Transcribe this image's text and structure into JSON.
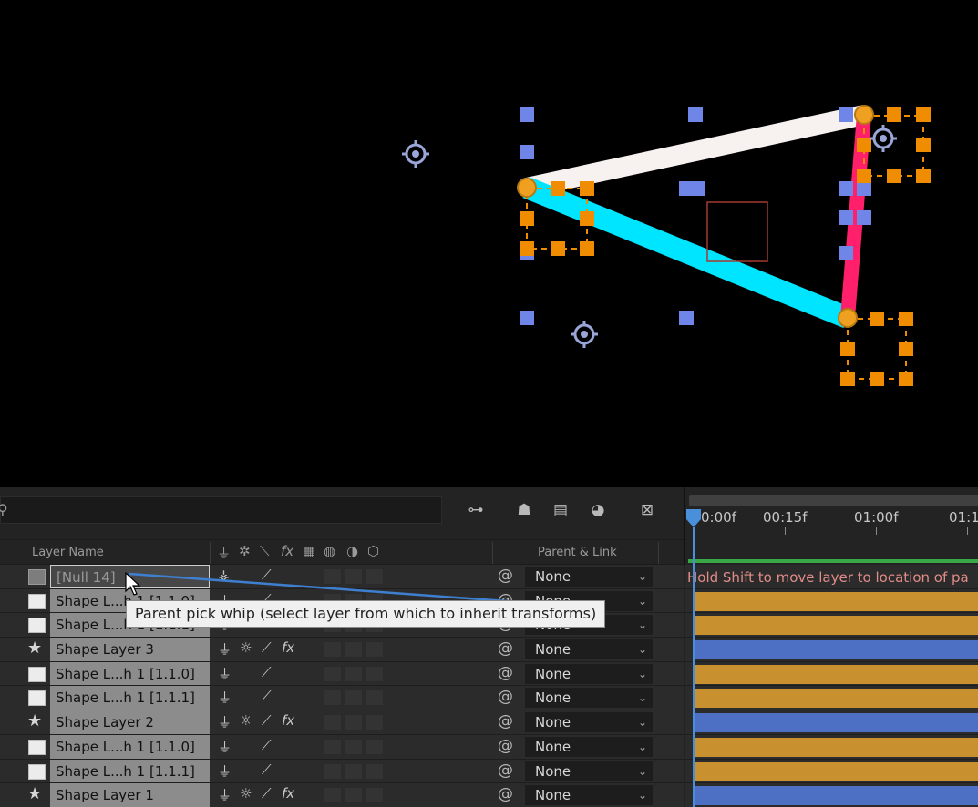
{
  "timeline": {
    "search_placeholder": "",
    "columns": {
      "layer_name": "Layer Name",
      "parent_link": "Parent & Link"
    },
    "ruler": [
      "0:00f",
      "00:15f",
      "01:00f",
      "01:1"
    ],
    "hint": "Hold Shift to move layer to location of pa",
    "tooltip": "Parent pick whip (select layer from which to inherit transforms)",
    "layers": [
      {
        "name": "[Null 14]",
        "type": "null",
        "parent": "None",
        "bar": "hint"
      },
      {
        "name": "Shape L...h 1 [1.1.0]",
        "type": "solid",
        "parent": "None",
        "bar": "orange"
      },
      {
        "name": "Shape L...h 1 [1.1.1]",
        "type": "solid",
        "parent": "None",
        "bar": "orange"
      },
      {
        "name": "Shape Layer 3",
        "type": "star",
        "parent": "None",
        "bar": "blue"
      },
      {
        "name": "Shape L...h 1 [1.1.0]",
        "type": "solid",
        "parent": "None",
        "bar": "orange"
      },
      {
        "name": "Shape L...h 1 [1.1.1]",
        "type": "solid",
        "parent": "None",
        "bar": "orange"
      },
      {
        "name": "Shape Layer 2",
        "type": "star",
        "parent": "None",
        "bar": "blue"
      },
      {
        "name": "Shape L...h 1 [1.1.0]",
        "type": "solid",
        "parent": "None",
        "bar": "orange"
      },
      {
        "name": "Shape L...h 1 [1.1.1]",
        "type": "solid",
        "parent": "None",
        "bar": "orange"
      },
      {
        "name": "Shape Layer 1",
        "type": "star",
        "parent": "None",
        "bar": "blue"
      }
    ]
  },
  "colors": {
    "accent_blue": "#4a8fd9",
    "bar_orange": "#c8902f",
    "bar_blue": "#4d6fc4",
    "cyan_stroke": "#00e5ff",
    "pink_stroke": "#ff1f6b",
    "handle_orange": "#f08c00",
    "handle_blue": "#6f86e8"
  }
}
